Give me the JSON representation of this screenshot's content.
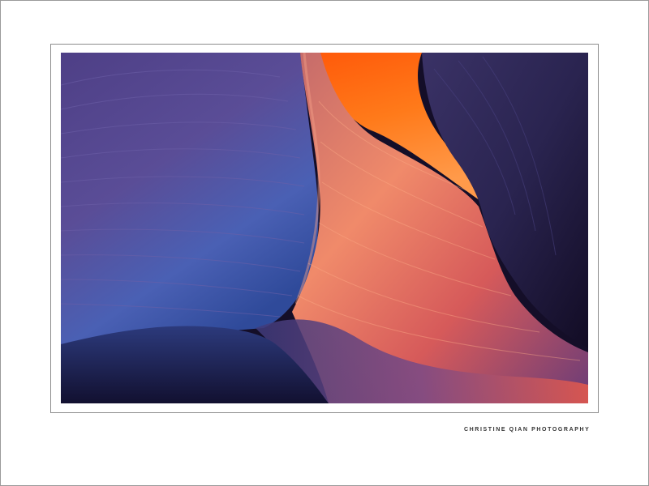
{
  "photo": {
    "subject": "slot-canyon-sandstone-photo",
    "palette": {
      "violet": "#5a4a92",
      "blue": "#3f64b8",
      "orange": "#ff6a10",
      "coral": "#e66a5a",
      "dark": "#120c24"
    }
  },
  "credit": {
    "text": "CHRISTINE QIAN PHOTOGRAPHY"
  }
}
